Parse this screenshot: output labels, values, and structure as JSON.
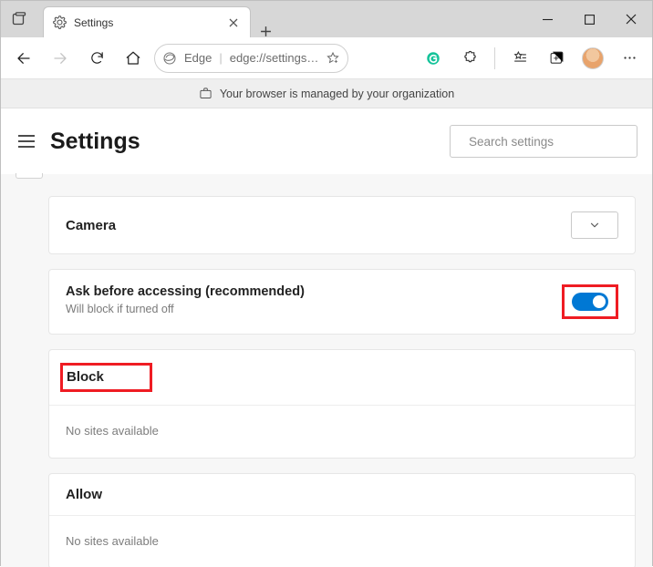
{
  "window": {
    "tab_title": "Settings"
  },
  "toolbar": {
    "edge_label": "Edge",
    "url": "edge://settings…"
  },
  "infobar": {
    "text": "Your browser is managed by your organization"
  },
  "header": {
    "title": "Settings",
    "search_placeholder": "Search settings"
  },
  "panel": {
    "camera": {
      "title": "Camera"
    },
    "ask": {
      "title": "Ask before accessing (recommended)",
      "sub": "Will block if turned off"
    },
    "block": {
      "title": "Block",
      "empty": "No sites available"
    },
    "allow": {
      "title": "Allow",
      "empty": "No sites available"
    }
  }
}
